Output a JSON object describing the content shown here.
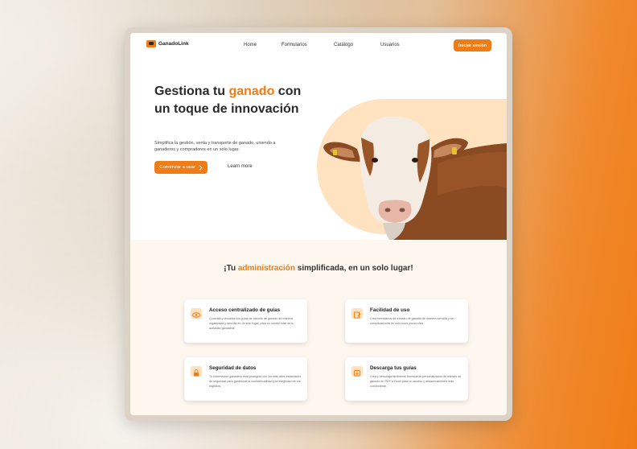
{
  "brand": {
    "name": "GanadoLink",
    "accent": "#f07c16"
  },
  "nav": {
    "links": [
      "Home",
      "Formularios",
      "Catálogo",
      "Usuarios"
    ],
    "login_label": "Iniciar sesión"
  },
  "hero": {
    "title_part1": "Gestiona tu ",
    "title_accent": "ganado",
    "title_part2": " con un toque de innovación",
    "description": "Simplifica la gestión, venta y transporte de ganado, uniendo a ganaderos y compradores en un solo lugar.",
    "cta_label": "Comenzar a usar",
    "learn_label": "Learn more"
  },
  "features": {
    "title_part1": "¡Tu ",
    "title_accent": "administración",
    "title_part2": " simplificada, en un solo lugar!",
    "cards": [
      {
        "icon": "eye-icon",
        "title": "Acceso centralizado de guías",
        "description": "Consulta y visualiza tus guías de tránsito de ganado de manera organizada y sencilla en un solo lugar, para un control total de tu actividad ganadera."
      },
      {
        "icon": "edit-form-icon",
        "title": "Facilidad de uso",
        "description": "Crea formularios de tránsito de ganado de manera sencilla y sin complicaciones en solo unos pocos clics."
      },
      {
        "icon": "lock-icon",
        "title": "Seguridad de datos",
        "description": "Tu información ganadera está protegida con los más altos estándares de seguridad para garantizar la confidencialidad y la integridad de tus registros."
      },
      {
        "icon": "download-icon",
        "title": "Descarga tus guías",
        "description": "Crea y descarga fácilmente formularios personalizados de tránsito de ganado en PDF o Excel para un acceso y almacenamiento más conveniente."
      }
    ]
  }
}
